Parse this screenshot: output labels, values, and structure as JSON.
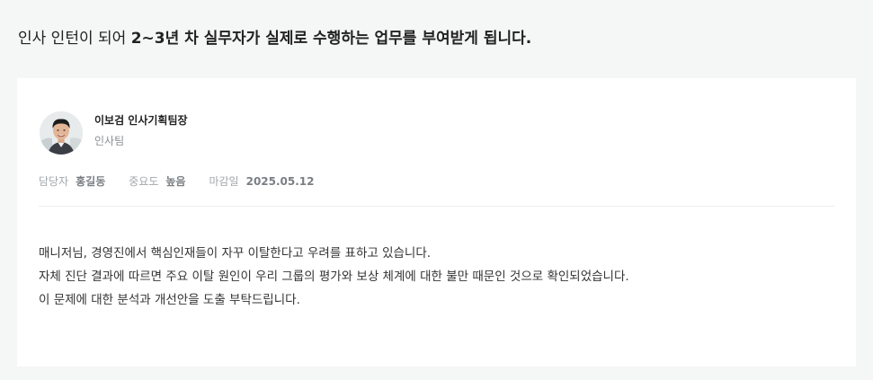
{
  "intro": {
    "lead": "인사 인턴이 되어 ",
    "emphasis": "2~3년 차 실무자가 실제로 수행하는 업무를 부여받게 됩니다."
  },
  "message": {
    "author_name": "이보검 인사기획팀장",
    "author_team": "인사팀",
    "meta": {
      "assignee_label": "담당자",
      "assignee_value": "홍길동",
      "priority_label": "중요도",
      "priority_value": "높음",
      "due_label": "마감일",
      "due_value": "2025.05.12"
    },
    "body_lines": [
      "매니저님, 경영진에서 핵심인재들이 자꾸 이탈한다고 우려를 표하고 있습니다.",
      "자체 진단 결과에 따르면 주요 이탈 원인이 우리 그룹의 평가와 보상 체계에 대한 불만 때문인 것으로 확인되었습니다.",
      "이 문제에 대한 분석과 개선안을 도출 부탁드립니다."
    ]
  },
  "colors": {
    "page_bg": "#f5f6f6",
    "card_bg": "#ffffff",
    "muted_text": "#a3a7ab"
  },
  "icons": {
    "avatar": "person-avatar-photo"
  }
}
